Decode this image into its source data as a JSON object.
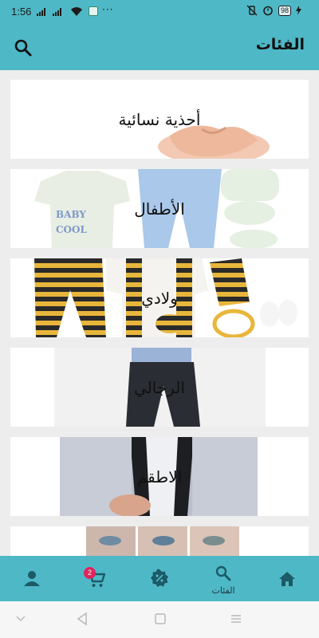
{
  "status_bar": {
    "time": "1:56",
    "dots": "···",
    "battery": "98"
  },
  "app_bar": {
    "title": "الفئات"
  },
  "categories": [
    {
      "label": "أحذية نسائية"
    },
    {
      "label": "الأطفال",
      "art_text": [
        "BABY",
        "COOL"
      ]
    },
    {
      "label": "ولادي"
    },
    {
      "label": "الرجالي"
    },
    {
      "label": "الاطقم"
    },
    {
      "label": ""
    }
  ],
  "bottom_nav": {
    "categories_label": "الفئات",
    "cart_badge": "2"
  },
  "colors": {
    "accent": "#4fb8c6",
    "icon": "#1b5a66",
    "badge": "#e0245e"
  }
}
